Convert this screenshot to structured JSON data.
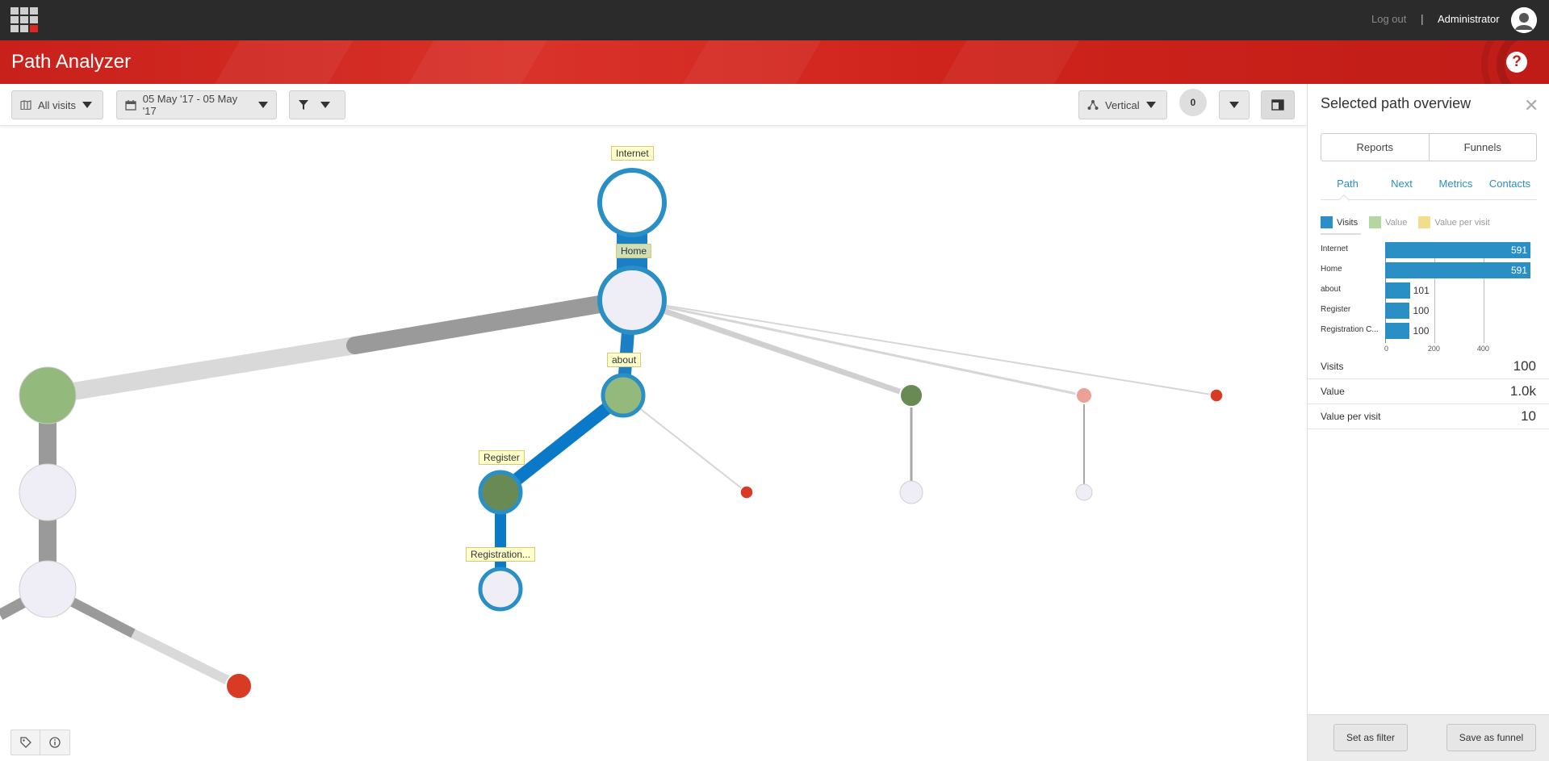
{
  "topbar": {
    "logout_label": "Log out",
    "separator": "|",
    "username": "Administrator"
  },
  "header": {
    "title": "Path Analyzer",
    "help_glyph": "?"
  },
  "toolbar": {
    "segment_label": "All visits",
    "date_range": "05 May '17 - 05 May '17",
    "layout_label": "Vertical",
    "count": "0"
  },
  "canvas": {
    "labels": {
      "internet": "Internet",
      "home": "Home",
      "about": "about",
      "register": "Register",
      "registration": "Registration..."
    }
  },
  "panel": {
    "title": "Selected path overview",
    "close_glyph": "✕",
    "segments": [
      "Reports",
      "Funnels"
    ],
    "tabs": [
      "Path",
      "Next",
      "Metrics",
      "Contacts"
    ],
    "legend": [
      {
        "label": "Visits",
        "color": "#2a8fc4"
      },
      {
        "label": "Value",
        "color": "#b5d6a1"
      },
      {
        "label": "Value per visit",
        "color": "#f3dc8c"
      }
    ],
    "metrics": [
      {
        "label": "Visits",
        "value": "100"
      },
      {
        "label": "Value",
        "value": "1.0k"
      },
      {
        "label": "Value per visit",
        "value": "10"
      }
    ],
    "footer": {
      "set_filter": "Set as filter",
      "save_funnel": "Save as funnel"
    }
  },
  "chart_data": {
    "type": "bar",
    "orientation": "horizontal",
    "categories": [
      "Internet",
      "Home",
      "about",
      "Register",
      "Registration C..."
    ],
    "series": [
      {
        "name": "Visits",
        "values": [
          591,
          591,
          101,
          100,
          100
        ]
      }
    ],
    "xlim": [
      0,
      591
    ],
    "xticks": [
      "0",
      "200",
      "400"
    ],
    "xtick_values": [
      0,
      200,
      400
    ]
  },
  "colors": {
    "accent_blue": "#2a8fc4",
    "brand_red": "#c8201a",
    "node_green": "#93b97c",
    "node_dark_green": "#6a8a55",
    "node_red": "#d93a23",
    "node_pink": "#eba196"
  }
}
